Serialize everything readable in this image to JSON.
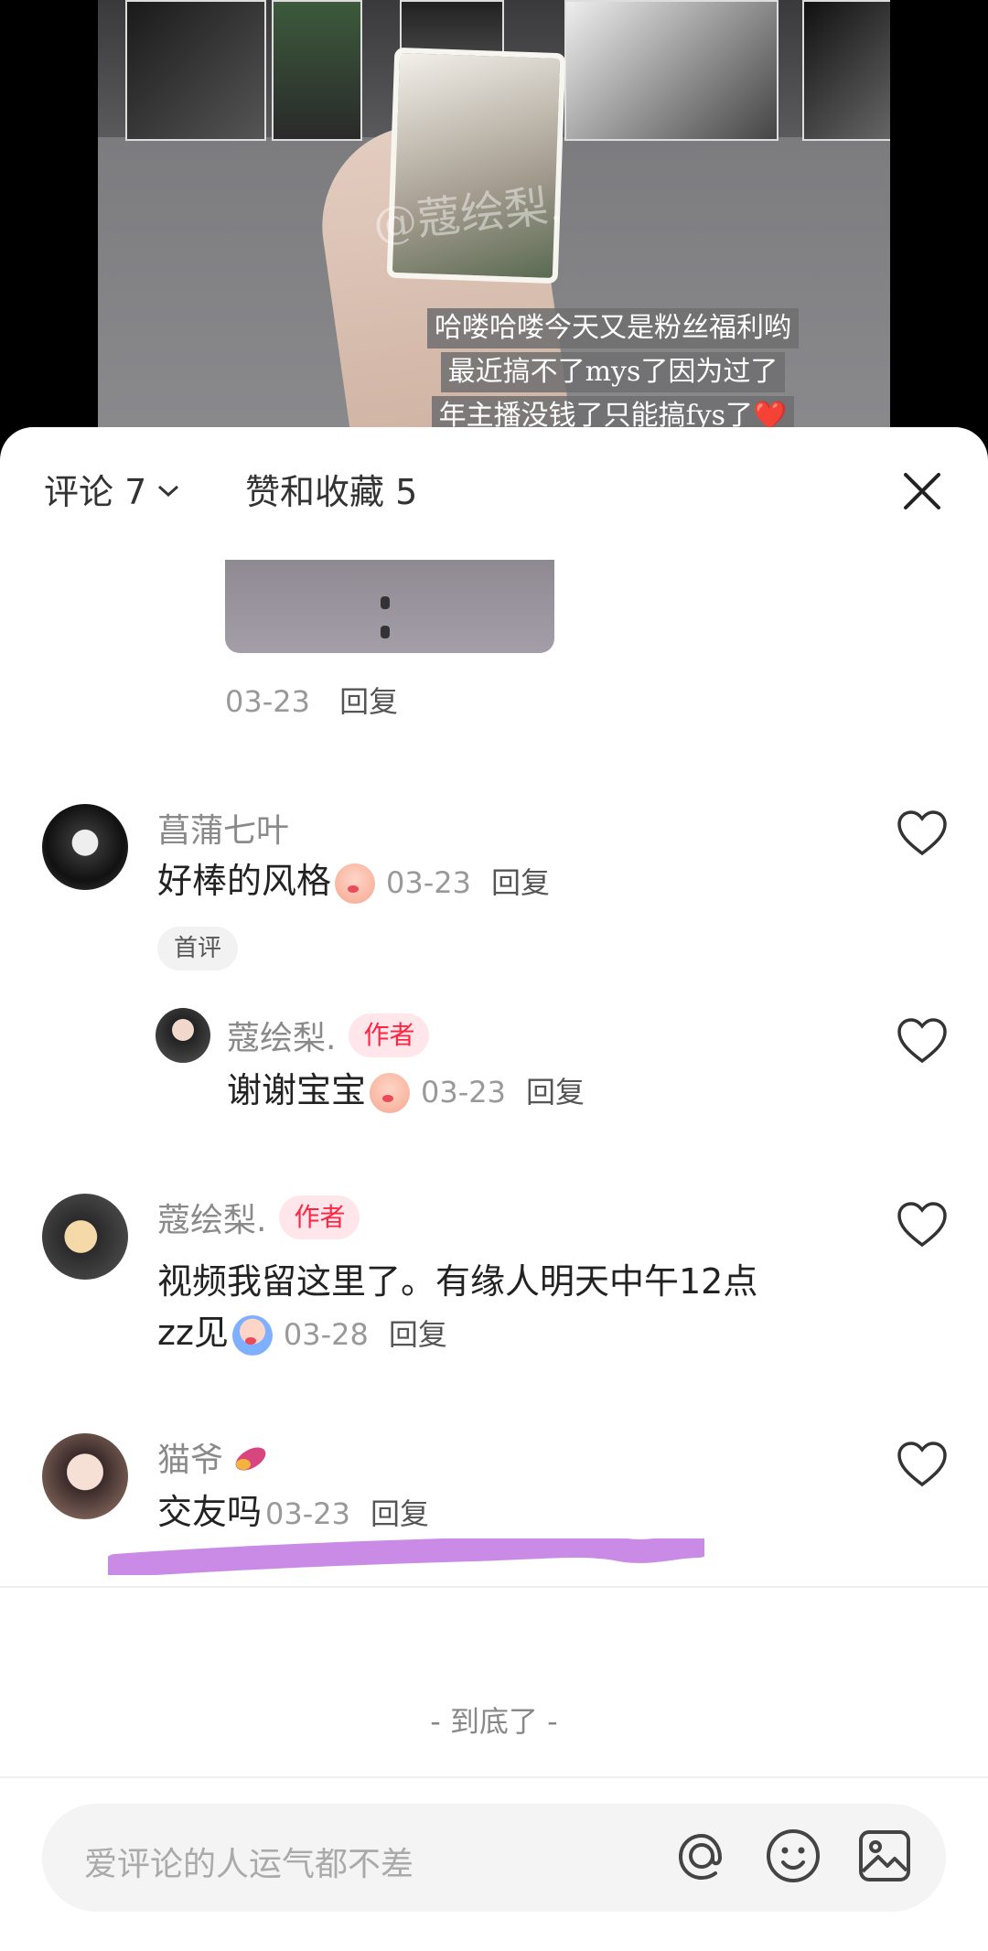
{
  "video": {
    "watermark": "@蔻绘梨.",
    "caption_lines": [
      "哈喽哈喽今天又是粉丝福利哟",
      "最近搞不了mys了因为过了",
      "年主播没钱了只能搞fys了❤️"
    ]
  },
  "tabs": {
    "comments_label": "评论 7",
    "likes_label": "赞和收藏 5"
  },
  "first_comment_tail": {
    "date": "03-23",
    "reply_label": "回复"
  },
  "comments": [
    {
      "username": "菖蒲七叶",
      "text": "好棒的风格",
      "date": "03-23",
      "reply_label": "回复",
      "tag": "首评"
    },
    {
      "username": "蔻绘梨.",
      "badge": "作者",
      "text": "谢谢宝宝",
      "date": "03-23",
      "reply_label": "回复"
    },
    {
      "username": "蔻绘梨.",
      "badge": "作者",
      "text_line1": "视频我留这里了。有缘人明天中午12点",
      "text_line2": "zz见",
      "date": "03-28",
      "reply_label": "回复"
    },
    {
      "username": "猫爷",
      "text": "交友吗",
      "date": "03-23",
      "reply_label": "回复"
    }
  ],
  "end_text": "- 到底了 -",
  "input": {
    "placeholder": "爱评论的人运气都不差"
  },
  "colors": {
    "accent": "#ff2442",
    "highlight_stroke": "#c98be6"
  }
}
